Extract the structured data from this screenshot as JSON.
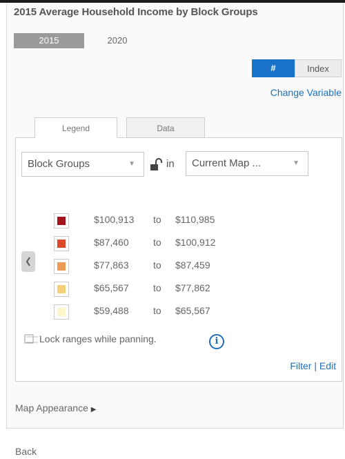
{
  "panel": {
    "title": "2015 Average Household Income by Block Groups"
  },
  "years": {
    "active": "2015",
    "other": "2020"
  },
  "display_toggle": {
    "number_icon": "hash-icon",
    "number_label": "#",
    "index_label": "Index",
    "active": "number"
  },
  "change_variable": "Change Variable",
  "tabs": {
    "legend": "Legend",
    "data": "Data"
  },
  "legend": {
    "geography_select": "Block Groups",
    "in_label": "in",
    "scope_select": "Current Map ...",
    "rows": [
      {
        "from": "$100,913",
        "to": "to",
        "upto": "$110,985",
        "color": "#a3141e"
      },
      {
        "from": "$87,460",
        "to": "to",
        "upto": "$100,912",
        "color": "#dc4a2a"
      },
      {
        "from": "$77,863",
        "to": "to",
        "upto": "$87,459",
        "color": "#ec9a55"
      },
      {
        "from": "$65,567",
        "to": "to",
        "upto": "$77,862",
        "color": "#f6cf7a"
      },
      {
        "from": "$59,488",
        "to": "to",
        "upto": "$65,567",
        "color": "#fdf6c8"
      }
    ],
    "lock_ranges_label": "Lock ranges while panning.",
    "filter_label": "Filter",
    "separator": "|",
    "edit_label": "Edit"
  },
  "map_appearance": "Map Appearance",
  "back": "Back"
}
